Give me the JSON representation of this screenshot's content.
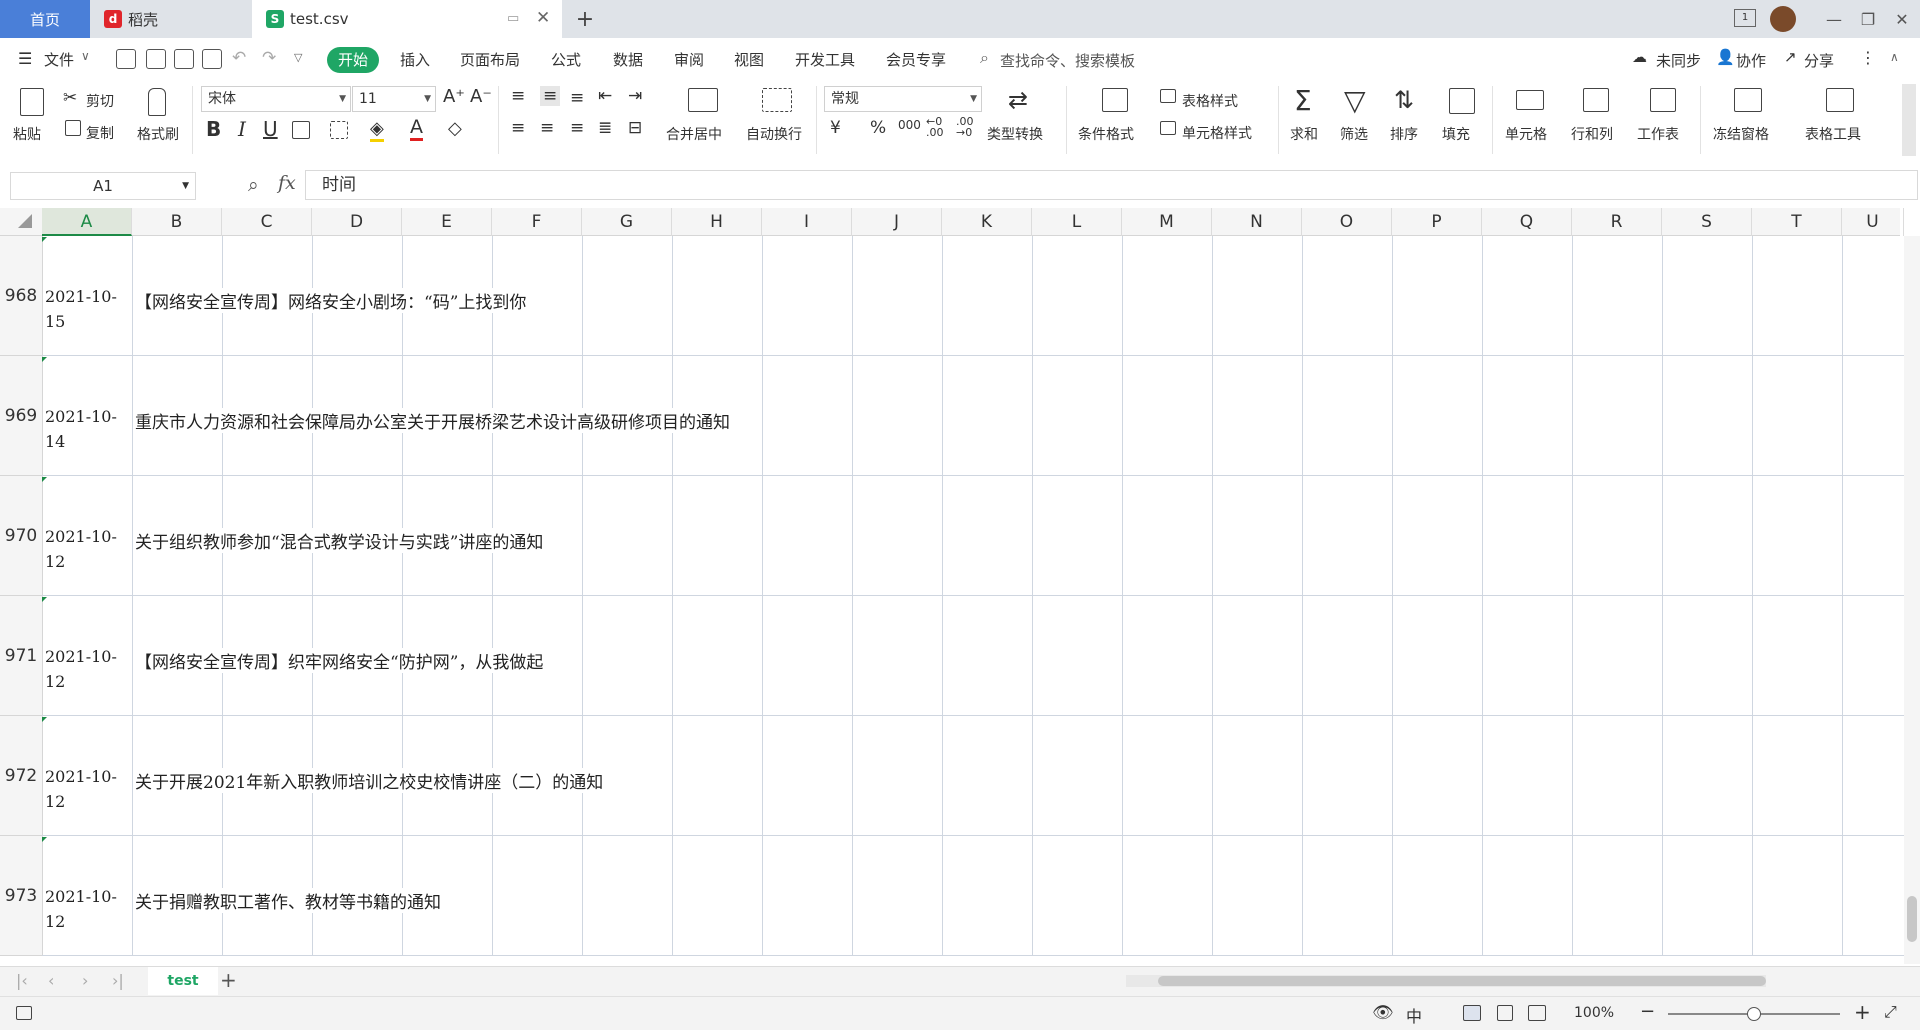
{
  "tabs": {
    "home": "首页",
    "daoke": "稻壳",
    "file": "test.csv"
  },
  "menu": [
    "文件",
    "开始",
    "插入",
    "页面布局",
    "公式",
    "数据",
    "审阅",
    "视图",
    "开发工具",
    "会员专享"
  ],
  "search_placeholder": "查找命令、搜索模板",
  "right_actions": {
    "sync": "未同步",
    "collab": "协作",
    "share": "分享"
  },
  "ribbon": {
    "paste": "粘贴",
    "cut": "剪切",
    "copy": "复制",
    "format_painter": "格式刷",
    "font_name": "宋体",
    "font_size": "11",
    "merge_center": "合并居中",
    "wrap_text": "自动换行",
    "number_format": "常规",
    "type_convert": "类型转换",
    "cond_format": "条件格式",
    "table_style": "表格样式",
    "cell_style": "单元格样式",
    "sum": "求和",
    "filter": "筛选",
    "sort": "排序",
    "fill": "填充",
    "cell": "单元格",
    "row_col": "行和列",
    "worksheet": "工作表",
    "freeze": "冻结窗格",
    "table_tools": "表格工具"
  },
  "namebox": "A1",
  "fx": "fx",
  "formula_value": "时间",
  "columns": [
    "A",
    "B",
    "C",
    "D",
    "E",
    "F",
    "G",
    "H",
    "I",
    "J",
    "K",
    "L",
    "M",
    "N",
    "O",
    "P",
    "Q",
    "R",
    "S",
    "T",
    "U"
  ],
  "rows": [
    {
      "num": "968",
      "date_line1": "2021-10-",
      "date_line2": "15",
      "title": "【网络安全宣传周】网络安全小剧场：“码”上找到你"
    },
    {
      "num": "969",
      "date_line1": "2021-10-",
      "date_line2": "14",
      "title": "重庆市人力资源和社会保障局办公室关于开展桥梁艺术设计高级研修项目的通知"
    },
    {
      "num": "970",
      "date_line1": "2021-10-",
      "date_line2": "12",
      "title": "关于组织教师参加“混合式教学设计与实践”讲座的通知"
    },
    {
      "num": "971",
      "date_line1": "2021-10-",
      "date_line2": "12",
      "title": "【网络安全宣传周】织牢网络安全“防护网”，从我做起"
    },
    {
      "num": "972",
      "date_line1": "2021-10-",
      "date_line2": "12",
      "title": "关于开展2021年新入职教师培训之校史校情讲座（二）的通知"
    },
    {
      "num": "973",
      "date_line1": "2021-10-",
      "date_line2": "12",
      "title": "关于捐赠教职工著作、教材等书籍的通知"
    }
  ],
  "sheet_tab": "test",
  "zoom": "100%",
  "ime": "中",
  "zoom_slider_fraction": 0.5
}
